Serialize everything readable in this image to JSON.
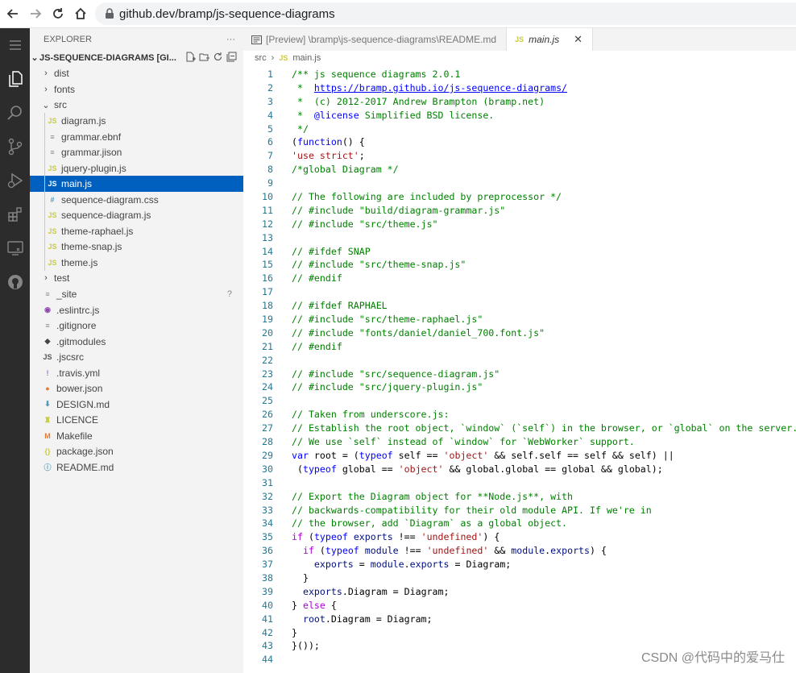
{
  "browser": {
    "url": "github.dev/bramp/js-sequence-diagrams"
  },
  "explorer": {
    "title": "EXPLORER",
    "more": "···",
    "root": "JS-SEQUENCE-DIAGRAMS [GI...",
    "items": [
      {
        "label": "dist",
        "kind": "folder",
        "indent": 1,
        "chev": "›",
        "icon": ""
      },
      {
        "label": "fonts",
        "kind": "folder",
        "indent": 1,
        "chev": "›",
        "icon": ""
      },
      {
        "label": "src",
        "kind": "folder",
        "indent": 1,
        "chev": "⌄",
        "icon": ""
      },
      {
        "label": "diagram.js",
        "kind": "js",
        "indent": 2,
        "icon": "JS"
      },
      {
        "label": "grammar.ebnf",
        "kind": "txt",
        "indent": 2,
        "icon": "≡"
      },
      {
        "label": "grammar.jison",
        "kind": "txt",
        "indent": 2,
        "icon": "≡"
      },
      {
        "label": "jquery-plugin.js",
        "kind": "js",
        "indent": 2,
        "icon": "JS"
      },
      {
        "label": "main.js",
        "kind": "js",
        "indent": 2,
        "icon": "JS",
        "selected": true
      },
      {
        "label": "sequence-diagram.css",
        "kind": "css",
        "indent": 2,
        "icon": "#"
      },
      {
        "label": "sequence-diagram.js",
        "kind": "js",
        "indent": 2,
        "icon": "JS"
      },
      {
        "label": "theme-raphael.js",
        "kind": "js",
        "indent": 2,
        "icon": "JS"
      },
      {
        "label": "theme-snap.js",
        "kind": "js",
        "indent": 2,
        "icon": "JS"
      },
      {
        "label": "theme.js",
        "kind": "js",
        "indent": 2,
        "icon": "JS"
      },
      {
        "label": "test",
        "kind": "folder",
        "indent": 1,
        "chev": "›",
        "icon": ""
      },
      {
        "label": "_site",
        "kind": "txt",
        "indent": 1,
        "icon": "≡",
        "badge": "?"
      },
      {
        "label": ".eslintrc.js",
        "kind": "eslint",
        "indent": 1,
        "icon": "◉"
      },
      {
        "label": ".gitignore",
        "kind": "txt",
        "indent": 1,
        "icon": "≡"
      },
      {
        "label": ".gitmodules",
        "kind": "git",
        "indent": 1,
        "icon": "◆"
      },
      {
        "label": ".jscsrc",
        "kind": "jsgray",
        "indent": 1,
        "icon": "JS"
      },
      {
        "label": ".travis.yml",
        "kind": "yml",
        "indent": 1,
        "icon": "!"
      },
      {
        "label": "bower.json",
        "kind": "bower",
        "indent": 1,
        "icon": "●"
      },
      {
        "label": "DESIGN.md",
        "kind": "md",
        "indent": 1,
        "icon": "⬇"
      },
      {
        "label": "LICENCE",
        "kind": "lic",
        "indent": 1,
        "icon": "♜"
      },
      {
        "label": "Makefile",
        "kind": "make",
        "indent": 1,
        "icon": "M"
      },
      {
        "label": "package.json",
        "kind": "json",
        "indent": 1,
        "icon": "{}"
      },
      {
        "label": "README.md",
        "kind": "info",
        "indent": 1,
        "icon": "ⓘ"
      }
    ]
  },
  "tabs": [
    {
      "label": "[Preview] \\bramp\\js-sequence-diagrams\\README.md",
      "active": false
    },
    {
      "label": "main.js",
      "active": true
    }
  ],
  "breadcrumb": {
    "folder": "src",
    "file": "main.js"
  },
  "code_lines": [
    [
      [
        "c",
        "/** js sequence diagrams 2.0.1"
      ]
    ],
    [
      [
        "c",
        " *  "
      ],
      [
        "l",
        "https://bramp.github.io/js-sequence-diagrams/"
      ]
    ],
    [
      [
        "c",
        " *  (c) 2012-2017 Andrew Brampton (bramp.net)"
      ]
    ],
    [
      [
        "c",
        " *  "
      ],
      [
        "k",
        "@license"
      ],
      [
        "c",
        " Simplified BSD license."
      ]
    ],
    [
      [
        "c",
        " */"
      ]
    ],
    [
      [
        "n",
        "("
      ],
      [
        "k",
        "function"
      ],
      [
        "n",
        "() {"
      ]
    ],
    [
      [
        "s",
        "'use strict'"
      ],
      [
        "n",
        ";"
      ]
    ],
    [
      [
        "c",
        "/*global Diagram */"
      ]
    ],
    [],
    [
      [
        "c",
        "// The following are included by preprocessor */"
      ]
    ],
    [
      [
        "c",
        "// #include \"build/diagram-grammar.js\""
      ]
    ],
    [
      [
        "c",
        "// #include \"src/theme.js\""
      ]
    ],
    [],
    [
      [
        "c",
        "// #ifdef SNAP"
      ]
    ],
    [
      [
        "c",
        "// #include \"src/theme-snap.js\""
      ]
    ],
    [
      [
        "c",
        "// #endif"
      ]
    ],
    [],
    [
      [
        "c",
        "// #ifdef RAPHAEL"
      ]
    ],
    [
      [
        "c",
        "// #include \"src/theme-raphael.js\""
      ]
    ],
    [
      [
        "c",
        "// #include \"fonts/daniel/daniel_700.font.js\""
      ]
    ],
    [
      [
        "c",
        "// #endif"
      ]
    ],
    [],
    [
      [
        "c",
        "// #include \"src/sequence-diagram.js\""
      ]
    ],
    [
      [
        "c",
        "// #include \"src/jquery-plugin.js\""
      ]
    ],
    [],
    [
      [
        "c",
        "// Taken from underscore.js:"
      ]
    ],
    [
      [
        "c",
        "// Establish the root object, `window` (`self`) in the browser, or `global` on the server."
      ]
    ],
    [
      [
        "c",
        "// We use `self` instead of `window` for `WebWorker` support."
      ]
    ],
    [
      [
        "k",
        "var"
      ],
      [
        "n",
        " root = ("
      ],
      [
        "k",
        "typeof"
      ],
      [
        "n",
        " self == "
      ],
      [
        "s",
        "'object'"
      ],
      [
        "n",
        " && self.self == self && self) ||"
      ]
    ],
    [
      [
        "n",
        " ("
      ],
      [
        "k",
        "typeof"
      ],
      [
        "n",
        " global == "
      ],
      [
        "s",
        "'object'"
      ],
      [
        "n",
        " && global.global == global && global);"
      ]
    ],
    [],
    [
      [
        "c",
        "// Export the Diagram object for **Node.js**, with"
      ]
    ],
    [
      [
        "c",
        "// backwards-compatibility for their old module API. If we're in"
      ]
    ],
    [
      [
        "c",
        "// the browser, add `Diagram` as a global object."
      ]
    ],
    [
      [
        "ctl",
        "if"
      ],
      [
        "n",
        " ("
      ],
      [
        "k",
        "typeof"
      ],
      [
        "n",
        " "
      ],
      [
        "v",
        "exports"
      ],
      [
        "n",
        " !== "
      ],
      [
        "s",
        "'undefined'"
      ],
      [
        "n",
        ") {"
      ]
    ],
    [
      [
        "n",
        "  "
      ],
      [
        "ctl",
        "if"
      ],
      [
        "n",
        " ("
      ],
      [
        "k",
        "typeof"
      ],
      [
        "n",
        " "
      ],
      [
        "v",
        "module"
      ],
      [
        "n",
        " !== "
      ],
      [
        "s",
        "'undefined'"
      ],
      [
        "n",
        " && "
      ],
      [
        "v",
        "module"
      ],
      [
        "n",
        "."
      ],
      [
        "v",
        "exports"
      ],
      [
        "n",
        ") {"
      ]
    ],
    [
      [
        "n",
        "    "
      ],
      [
        "v",
        "exports"
      ],
      [
        "n",
        " = "
      ],
      [
        "v",
        "module"
      ],
      [
        "n",
        "."
      ],
      [
        "v",
        "exports"
      ],
      [
        "n",
        " = Diagram;"
      ]
    ],
    [
      [
        "n",
        "  }"
      ]
    ],
    [
      [
        "n",
        "  "
      ],
      [
        "v",
        "exports"
      ],
      [
        "n",
        ".Diagram = Diagram;"
      ]
    ],
    [
      [
        "n",
        "} "
      ],
      [
        "ctl",
        "else"
      ],
      [
        "n",
        " {"
      ]
    ],
    [
      [
        "n",
        "  "
      ],
      [
        "v",
        "root"
      ],
      [
        "n",
        ".Diagram = Diagram;"
      ]
    ],
    [
      [
        "n",
        "}"
      ]
    ],
    [
      [
        "n",
        "}());"
      ]
    ],
    []
  ],
  "watermark": "CSDN @代码中的爱马仕",
  "colors": {
    "accent": "#0060c0",
    "activity_bar": "#2c2c2c",
    "sidebar": "#f3f3f3"
  }
}
